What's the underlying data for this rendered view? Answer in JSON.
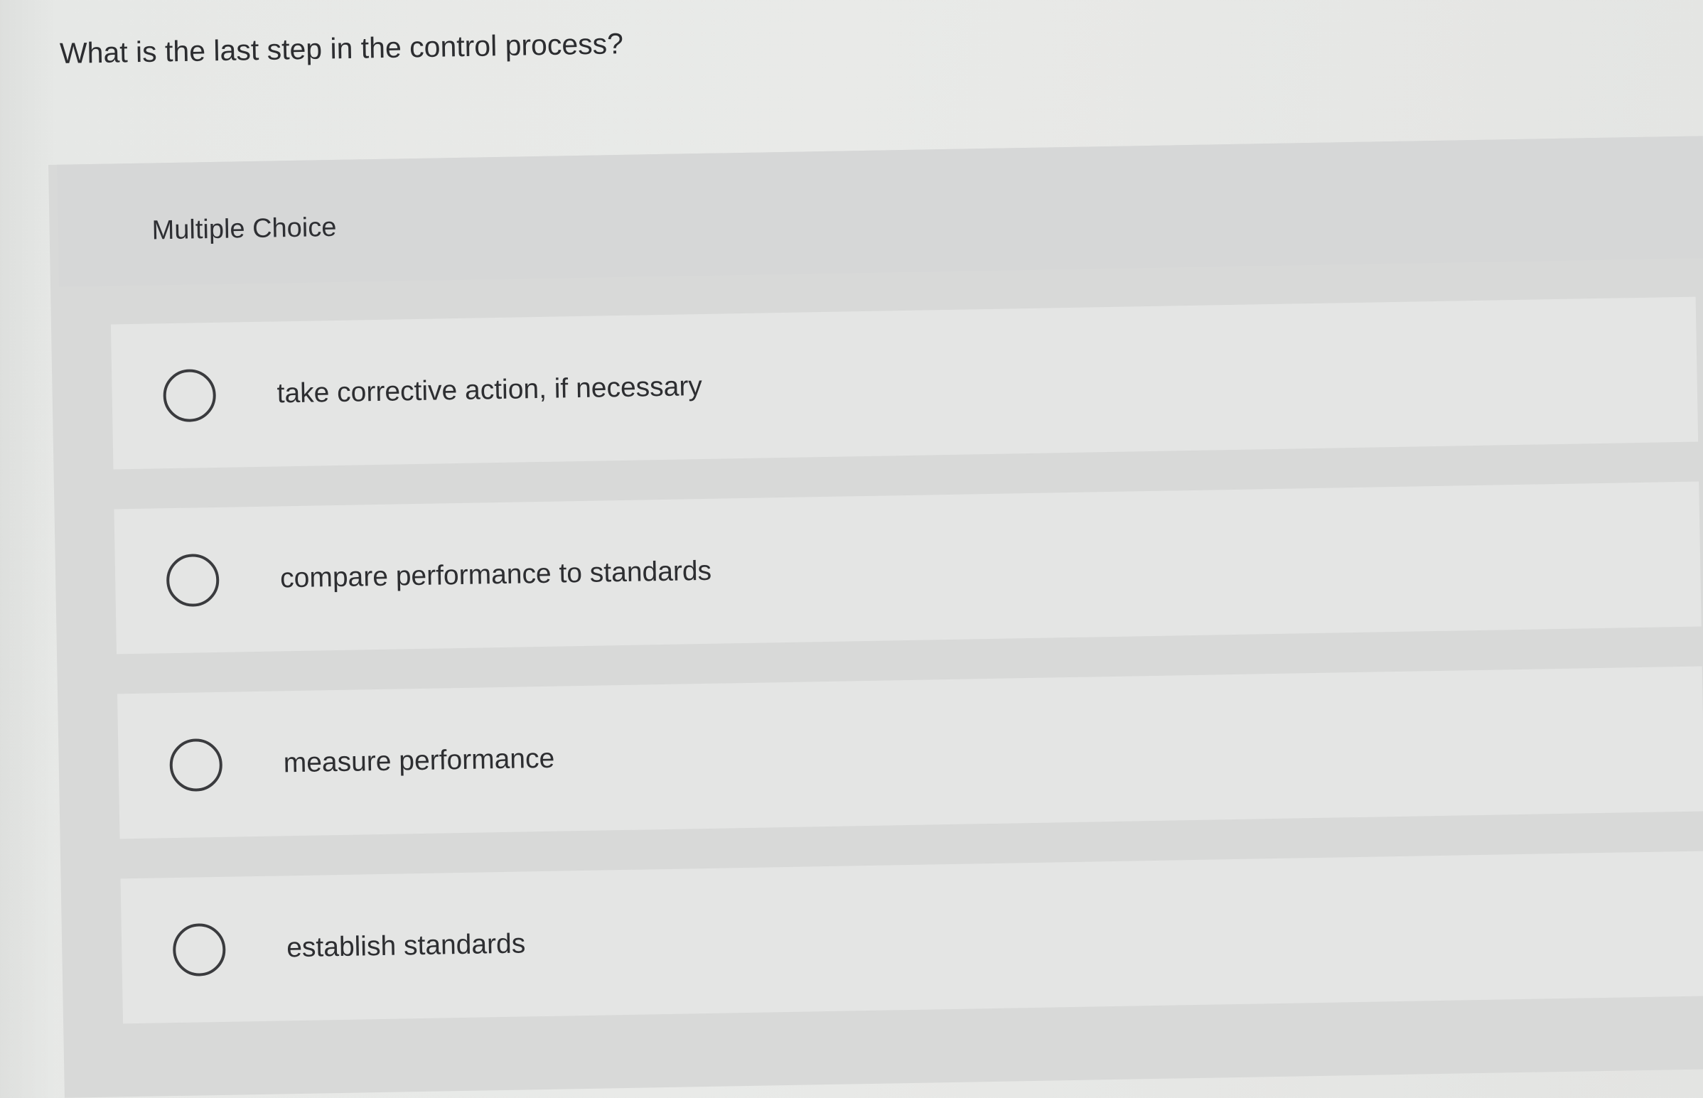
{
  "question": {
    "text": "What is the last step in the control process?"
  },
  "panel": {
    "header_label": "Multiple Choice"
  },
  "choices": [
    {
      "label": "take corrective action, if necessary",
      "selected": false
    },
    {
      "label": "compare performance to standards",
      "selected": false
    },
    {
      "label": "measure performance",
      "selected": false
    },
    {
      "label": "establish standards",
      "selected": false
    }
  ]
}
